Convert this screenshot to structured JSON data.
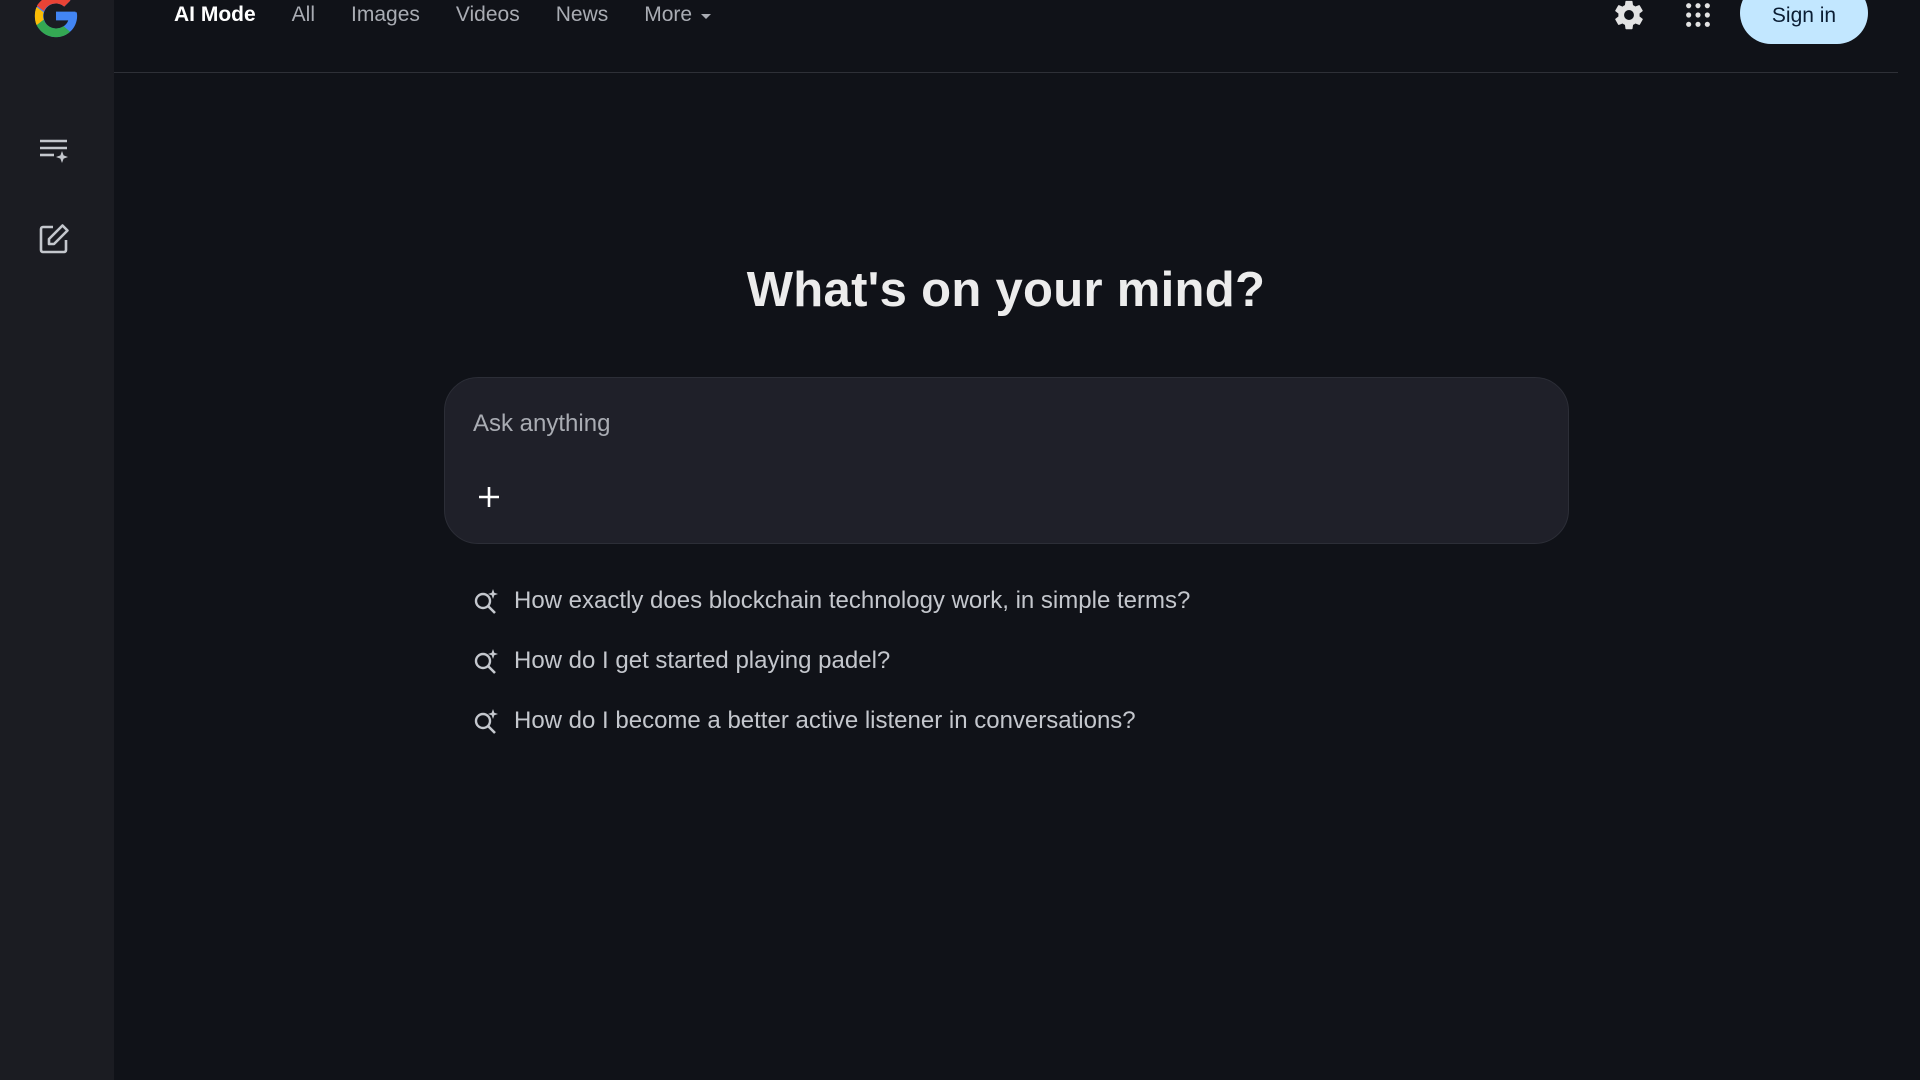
{
  "sidebar": {
    "logo_icon": "google-g-logo",
    "history_icon": "history-list-icon",
    "new_chat_icon": "edit-square-icon"
  },
  "header": {
    "tabs": [
      {
        "label": "AI Mode",
        "active": true
      },
      {
        "label": "All"
      },
      {
        "label": "Images"
      },
      {
        "label": "Videos"
      },
      {
        "label": "News"
      },
      {
        "label": "More"
      }
    ],
    "settings_icon": "gear-icon",
    "apps_icon": "apps-grid-icon",
    "sign_in_label": "Sign in"
  },
  "main": {
    "title": "What's on your mind?",
    "prompt_placeholder": "Ask anything",
    "suggestions": [
      "How exactly does blockchain technology work, in simple terms?",
      "How do I get started playing padel?",
      "How do I become a better active listener in conversations?"
    ]
  },
  "colors": {
    "background": "#101218",
    "sidebar": "#1b1c22",
    "prompt_box": "#1f2029",
    "sign_in_bg": "#c2e7ff"
  }
}
